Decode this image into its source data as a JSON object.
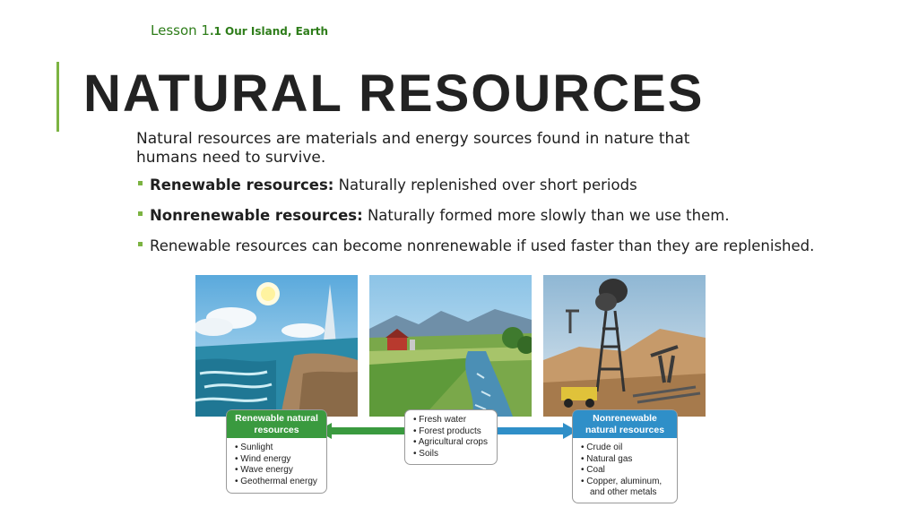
{
  "lesson": {
    "label": "Lesson 1",
    "number": ".1",
    "name": " Our Island, Earth"
  },
  "title": "NATURAL RESOURCES",
  "intro": "Natural resources are materials and energy sources found in nature that humans need to survive.",
  "bullets": [
    {
      "bold": "Renewable resources:",
      "text": " Naturally replenished over short periods"
    },
    {
      "bold": "Nonrenewable resources:",
      "text": " Naturally formed more slowly than we use them."
    },
    {
      "bold": "",
      "text": "Renewable resources can become nonrenewable if used faster than they are replenished."
    }
  ],
  "diagram": {
    "renewable": {
      "heading": "Renewable natural resources",
      "items": [
        "Sunlight",
        "Wind energy",
        "Wave energy",
        "Geothermal energy"
      ],
      "color": "#3a9a3f"
    },
    "middle": {
      "items": [
        "Fresh water",
        "Forest products",
        "Agricultural crops",
        "Soils"
      ]
    },
    "nonrenewable": {
      "heading": "Nonrenewable natural resources",
      "items": [
        "Crude oil",
        "Natural gas",
        "Coal",
        "Copper, aluminum,",
        "and other metals"
      ],
      "color": "#2f8fc8"
    }
  },
  "colors": {
    "accent": "#7cb342",
    "lesson_text": "#2e7d1a"
  }
}
